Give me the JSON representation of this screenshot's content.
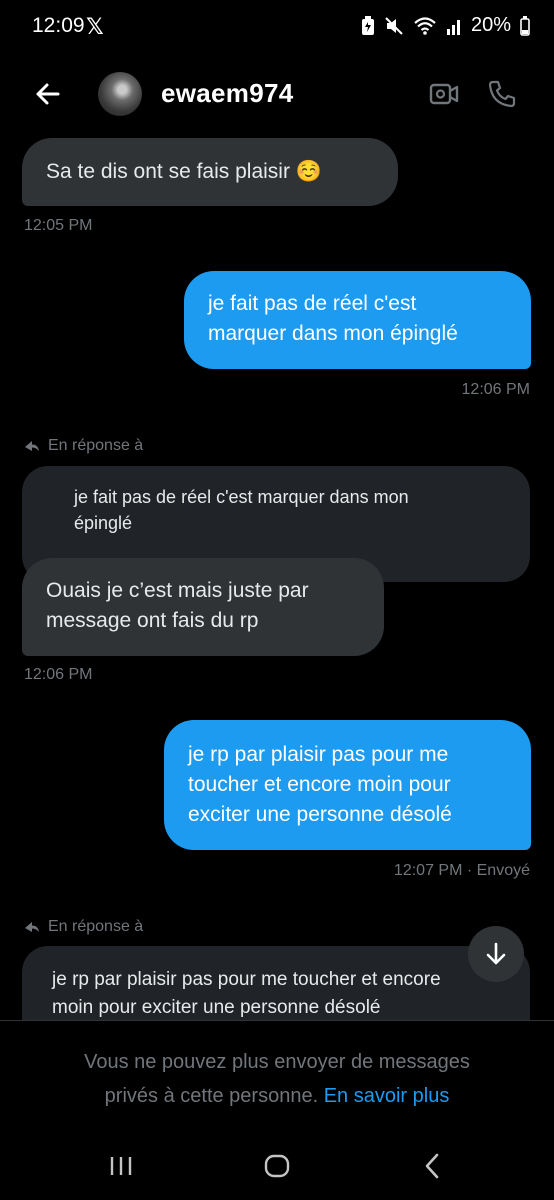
{
  "status": {
    "time": "12:09",
    "x_logo": "𝕏",
    "battery": "20%"
  },
  "header": {
    "back_icon": "arrow-left-icon",
    "username": "ewaem974",
    "video_icon": "video-camera-icon",
    "call_icon": "phone-icon"
  },
  "messages": [
    {
      "text": "Sa te dis ont se fais plaisir ☺️",
      "time": "12:05 PM"
    },
    {
      "line1": "je fait pas de réel c'est",
      "line2": "marquer dans mon épinglé",
      "time": "12:06 PM"
    },
    {
      "reply_label": "En réponse à",
      "quote_line1": "je fait pas de réel c'est marquer dans mon",
      "quote_line2": "épinglé",
      "line1": "Ouais je c’est mais juste par",
      "line2": "message ont fais du rp",
      "time": "12:06 PM"
    },
    {
      "line1": "je rp par plaisir pas pour me",
      "line2": "toucher et encore moin pour",
      "line3": "exciter une personne désolé",
      "time": "12:07 PM · Envoyé"
    },
    {
      "reply_label": "En réponse à",
      "quote_line1": "je rp par plaisir pas pour me toucher et encore",
      "quote_line2": "moin pour exciter une personne désolé"
    }
  ],
  "scroll_down_icon": "arrow-down-icon",
  "footer": {
    "line1": "Vous ne pouvez plus envoyer de messages",
    "line2_prefix": "privés à cette personne.",
    "link": "En savoir plus"
  },
  "navbar": {
    "recent_icon": "recent-apps-icon",
    "home_icon": "home-icon",
    "back_icon": "back-chevron-icon"
  },
  "colors": {
    "accent": "#1d9bf0",
    "incoming_bubble": "#2f3336",
    "muted_text": "#71767b"
  }
}
